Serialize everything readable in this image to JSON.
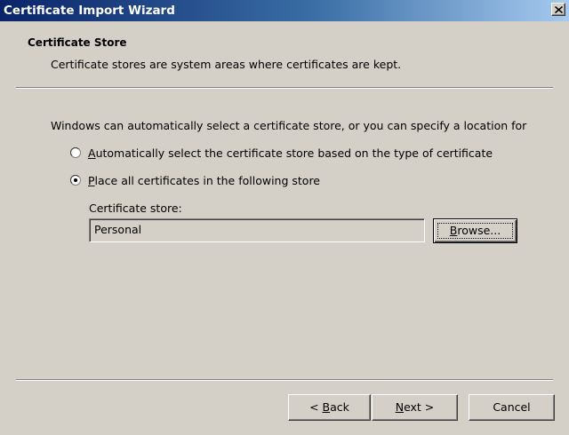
{
  "window": {
    "title": "Certificate Import Wizard"
  },
  "header": {
    "title": "Certificate Store",
    "description": "Certificate stores are system areas where certificates are kept."
  },
  "body": {
    "intro": "Windows can automatically select a certificate store, or you can specify a location for",
    "options": [
      {
        "accel": "A",
        "rest": "utomatically select the certificate store based on the type of certificate",
        "selected": false
      },
      {
        "accel": "P",
        "rest": "lace all certificates in the following store",
        "selected": true
      }
    ],
    "store_label": "Certificate store:",
    "store_value": "Personal",
    "browse": {
      "accel": "B",
      "rest": "rowse..."
    }
  },
  "footer": {
    "back": {
      "pre": "< ",
      "accel": "B",
      "rest": "ack"
    },
    "next": {
      "accel": "N",
      "rest": "ext >"
    },
    "cancel": "Cancel"
  }
}
